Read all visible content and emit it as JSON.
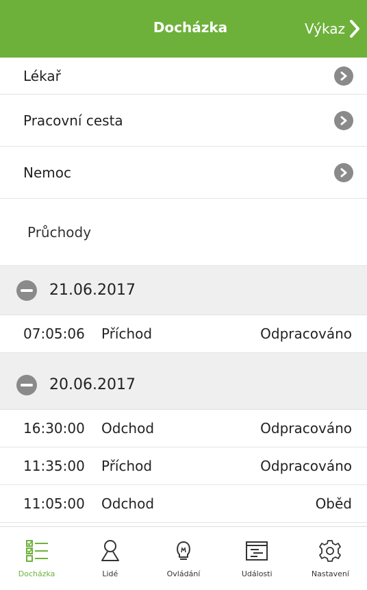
{
  "header": {
    "title": "Docházka",
    "next_label": "Výkaz"
  },
  "menu": {
    "items": [
      {
        "label": "Lékař"
      },
      {
        "label": "Pracovní cesta"
      },
      {
        "label": "Nemoc"
      }
    ]
  },
  "passages": {
    "label": "Průchody",
    "days": [
      {
        "date": "21.06.2017",
        "entries": [
          {
            "time": "07:05:06",
            "type": "Příchod",
            "status": "Odpracováno"
          }
        ]
      },
      {
        "date": "20.06.2017",
        "entries": [
          {
            "time": "16:30:00",
            "type": "Odchod",
            "status": "Odpracováno"
          },
          {
            "time": "11:35:00",
            "type": "Příchod",
            "status": "Odpracováno"
          },
          {
            "time": "11:05:00",
            "type": "Odchod",
            "status": "Oběd"
          }
        ]
      }
    ]
  },
  "tabs": [
    {
      "label": "Docházka",
      "icon": "attendance-list-icon",
      "active": true
    },
    {
      "label": "Lidé",
      "icon": "person-icon",
      "active": false
    },
    {
      "label": "Ovládání",
      "icon": "lightbulb-icon",
      "active": false
    },
    {
      "label": "Události",
      "icon": "events-icon",
      "active": false
    },
    {
      "label": "Nastavení",
      "icon": "gear-icon",
      "active": false
    }
  ],
  "colors": {
    "accent": "#6db13a",
    "chevron_bg": "#8a8a8a",
    "section_bg": "#efefef"
  }
}
